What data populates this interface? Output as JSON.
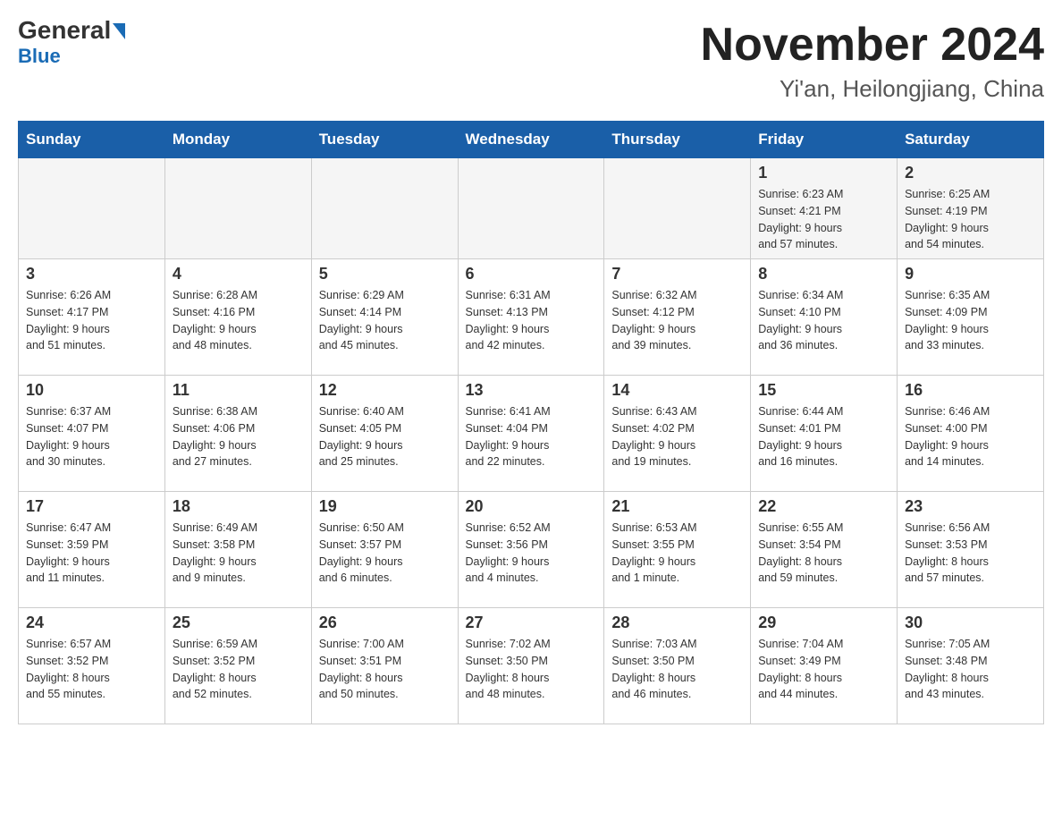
{
  "header": {
    "logo_text1": "General",
    "logo_text2": "Blue",
    "month_title": "November 2024",
    "location": "Yi'an, Heilongjiang, China"
  },
  "weekdays": [
    "Sunday",
    "Monday",
    "Tuesday",
    "Wednesday",
    "Thursday",
    "Friday",
    "Saturday"
  ],
  "weeks": [
    [
      {
        "day": "",
        "info": ""
      },
      {
        "day": "",
        "info": ""
      },
      {
        "day": "",
        "info": ""
      },
      {
        "day": "",
        "info": ""
      },
      {
        "day": "",
        "info": ""
      },
      {
        "day": "1",
        "info": "Sunrise: 6:23 AM\nSunset: 4:21 PM\nDaylight: 9 hours\nand 57 minutes."
      },
      {
        "day": "2",
        "info": "Sunrise: 6:25 AM\nSunset: 4:19 PM\nDaylight: 9 hours\nand 54 minutes."
      }
    ],
    [
      {
        "day": "3",
        "info": "Sunrise: 6:26 AM\nSunset: 4:17 PM\nDaylight: 9 hours\nand 51 minutes."
      },
      {
        "day": "4",
        "info": "Sunrise: 6:28 AM\nSunset: 4:16 PM\nDaylight: 9 hours\nand 48 minutes."
      },
      {
        "day": "5",
        "info": "Sunrise: 6:29 AM\nSunset: 4:14 PM\nDaylight: 9 hours\nand 45 minutes."
      },
      {
        "day": "6",
        "info": "Sunrise: 6:31 AM\nSunset: 4:13 PM\nDaylight: 9 hours\nand 42 minutes."
      },
      {
        "day": "7",
        "info": "Sunrise: 6:32 AM\nSunset: 4:12 PM\nDaylight: 9 hours\nand 39 minutes."
      },
      {
        "day": "8",
        "info": "Sunrise: 6:34 AM\nSunset: 4:10 PM\nDaylight: 9 hours\nand 36 minutes."
      },
      {
        "day": "9",
        "info": "Sunrise: 6:35 AM\nSunset: 4:09 PM\nDaylight: 9 hours\nand 33 minutes."
      }
    ],
    [
      {
        "day": "10",
        "info": "Sunrise: 6:37 AM\nSunset: 4:07 PM\nDaylight: 9 hours\nand 30 minutes."
      },
      {
        "day": "11",
        "info": "Sunrise: 6:38 AM\nSunset: 4:06 PM\nDaylight: 9 hours\nand 27 minutes."
      },
      {
        "day": "12",
        "info": "Sunrise: 6:40 AM\nSunset: 4:05 PM\nDaylight: 9 hours\nand 25 minutes."
      },
      {
        "day": "13",
        "info": "Sunrise: 6:41 AM\nSunset: 4:04 PM\nDaylight: 9 hours\nand 22 minutes."
      },
      {
        "day": "14",
        "info": "Sunrise: 6:43 AM\nSunset: 4:02 PM\nDaylight: 9 hours\nand 19 minutes."
      },
      {
        "day": "15",
        "info": "Sunrise: 6:44 AM\nSunset: 4:01 PM\nDaylight: 9 hours\nand 16 minutes."
      },
      {
        "day": "16",
        "info": "Sunrise: 6:46 AM\nSunset: 4:00 PM\nDaylight: 9 hours\nand 14 minutes."
      }
    ],
    [
      {
        "day": "17",
        "info": "Sunrise: 6:47 AM\nSunset: 3:59 PM\nDaylight: 9 hours\nand 11 minutes."
      },
      {
        "day": "18",
        "info": "Sunrise: 6:49 AM\nSunset: 3:58 PM\nDaylight: 9 hours\nand 9 minutes."
      },
      {
        "day": "19",
        "info": "Sunrise: 6:50 AM\nSunset: 3:57 PM\nDaylight: 9 hours\nand 6 minutes."
      },
      {
        "day": "20",
        "info": "Sunrise: 6:52 AM\nSunset: 3:56 PM\nDaylight: 9 hours\nand 4 minutes."
      },
      {
        "day": "21",
        "info": "Sunrise: 6:53 AM\nSunset: 3:55 PM\nDaylight: 9 hours\nand 1 minute."
      },
      {
        "day": "22",
        "info": "Sunrise: 6:55 AM\nSunset: 3:54 PM\nDaylight: 8 hours\nand 59 minutes."
      },
      {
        "day": "23",
        "info": "Sunrise: 6:56 AM\nSunset: 3:53 PM\nDaylight: 8 hours\nand 57 minutes."
      }
    ],
    [
      {
        "day": "24",
        "info": "Sunrise: 6:57 AM\nSunset: 3:52 PM\nDaylight: 8 hours\nand 55 minutes."
      },
      {
        "day": "25",
        "info": "Sunrise: 6:59 AM\nSunset: 3:52 PM\nDaylight: 8 hours\nand 52 minutes."
      },
      {
        "day": "26",
        "info": "Sunrise: 7:00 AM\nSunset: 3:51 PM\nDaylight: 8 hours\nand 50 minutes."
      },
      {
        "day": "27",
        "info": "Sunrise: 7:02 AM\nSunset: 3:50 PM\nDaylight: 8 hours\nand 48 minutes."
      },
      {
        "day": "28",
        "info": "Sunrise: 7:03 AM\nSunset: 3:50 PM\nDaylight: 8 hours\nand 46 minutes."
      },
      {
        "day": "29",
        "info": "Sunrise: 7:04 AM\nSunset: 3:49 PM\nDaylight: 8 hours\nand 44 minutes."
      },
      {
        "day": "30",
        "info": "Sunrise: 7:05 AM\nSunset: 3:48 PM\nDaylight: 8 hours\nand 43 minutes."
      }
    ]
  ]
}
